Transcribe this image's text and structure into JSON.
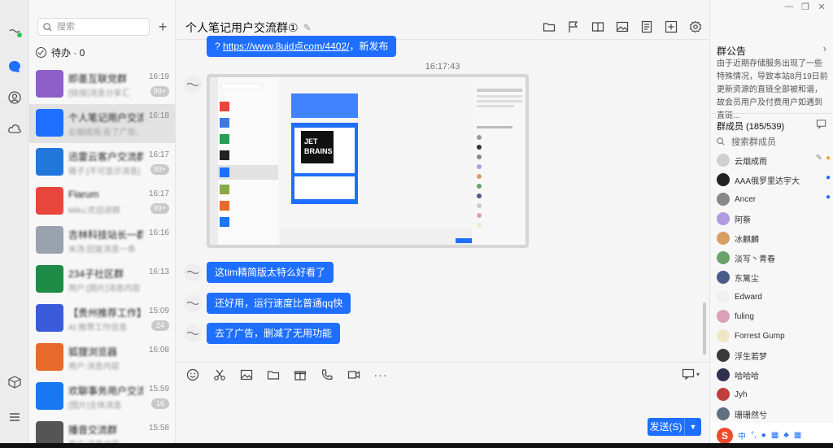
{
  "search": {
    "placeholder": "搜索"
  },
  "todo": {
    "label": "待办 · 0"
  },
  "conversations": [
    {
      "name": "即墨互联党群",
      "preview": "[链接]消息分享汇",
      "time": "16:19",
      "badge": "99+",
      "color": "#8f5fc9"
    },
    {
      "name": "个人笔记用户交流群",
      "preview": "云烟成雨:去了广告、删除",
      "time": "16:18",
      "badge": "",
      "color": "#1e6fff"
    },
    {
      "name": "迅雷云客户交流群",
      "preview": "猪子:[不可显示消息]",
      "time": "16:17",
      "badge": "99+",
      "color": "#2277dd"
    },
    {
      "name": "Flarum",
      "preview": "Miku:欢迎进群",
      "time": "16:17",
      "badge": "99+",
      "color": "#e8453c"
    },
    {
      "name": "吉林科技站长一群",
      "preview": "米汤:回复消息一条",
      "time": "16:16",
      "badge": "",
      "color": "#9aa3ad"
    },
    {
      "name": "234子社区群",
      "preview": "用户:[图片]消息内容",
      "time": "16:13",
      "badge": "",
      "color": "#1e8c46"
    },
    {
      "name": "【贵州推荐工作】",
      "preview": "AI:推荐工作信息",
      "time": "15:09",
      "badge": "24",
      "color": "#3a5bd9"
    },
    {
      "name": "狐狸浏览器",
      "preview": "用户:消息内容",
      "time": "16:08",
      "badge": "",
      "color": "#e86a2a"
    },
    {
      "name": "欢聊事务用户交流群",
      "preview": "[图片]全体消息",
      "time": "15:59",
      "badge": "16",
      "color": "#1877f2"
    },
    {
      "name": "播音交流群",
      "preview": "用户:消息内容",
      "time": "15:58",
      "badge": "",
      "color": "#555555"
    }
  ],
  "chat": {
    "title": "个人笔记用户交流群",
    "title_count": "①",
    "first_message": {
      "prefix": "? ",
      "link": "https://www.8uid点com/4402/",
      "suffix": "，新发布"
    },
    "timestamp": "16:17:43",
    "messages": [
      "这tim精简版太特么好看了",
      "还好用，运行速度比普通qq快",
      "去了广告，删减了无用功能"
    ],
    "send_label": "发送(S)"
  },
  "announcement": {
    "title": "群公告",
    "body": "由于近期存储服务出现了一些特殊情况，导致本站8月19日前更新资源的直链全部被和谐，故会员用户及付费用户如遇到直链..."
  },
  "members": {
    "title": "群成员 (185/539)",
    "search_placeholder": "搜索群成员",
    "list": [
      {
        "name": "云烟成雨",
        "color": "#cfcfcf",
        "edit": true,
        "admin": "owner"
      },
      {
        "name": "AAA俄罗里达宇大",
        "color": "#222222",
        "edit": false,
        "admin": "admin"
      },
      {
        "name": "Ancer",
        "color": "#888888",
        "edit": false,
        "admin": "admin"
      },
      {
        "name": "阿蔡",
        "color": "#b19be0",
        "edit": false,
        "admin": ""
      },
      {
        "name": "冰麒麟",
        "color": "#d6a060",
        "edit": false,
        "admin": ""
      },
      {
        "name": "淡写丶青春",
        "color": "#6aa36a",
        "edit": false,
        "admin": ""
      },
      {
        "name": "东篱尘",
        "color": "#4a5a8a",
        "edit": false,
        "admin": ""
      },
      {
        "name": "Edward",
        "color": "#f0f0f0",
        "edit": false,
        "admin": ""
      },
      {
        "name": "fuling",
        "color": "#d9a0b8",
        "edit": false,
        "admin": ""
      },
      {
        "name": "Forrest Gump",
        "color": "#f2e6c9",
        "edit": false,
        "admin": ""
      },
      {
        "name": "浮生若梦",
        "color": "#3a3a3a",
        "edit": false,
        "admin": ""
      },
      {
        "name": "哈哈哈",
        "color": "#303050",
        "edit": false,
        "admin": ""
      },
      {
        "name": "Jyh",
        "color": "#c04040",
        "edit": false,
        "admin": ""
      },
      {
        "name": "珊珊然兮",
        "color": "#607080",
        "edit": false,
        "admin": ""
      }
    ]
  },
  "tray": {
    "ime": "中",
    "punct": "°,"
  },
  "icons": {
    "rail": [
      "avatar-dot-icon",
      "chat-bubble-icon",
      "contacts-icon",
      "cloud-icon",
      "cube-icon",
      "menu-icon"
    ],
    "top": [
      "folder-icon",
      "flag-icon",
      "book-icon",
      "image-icon",
      "doc-icon",
      "add-box-icon",
      "settings-icon"
    ],
    "compose": [
      "emoji-icon",
      "scissors-icon",
      "image-icon",
      "folder-icon",
      "gift-icon",
      "phone-icon",
      "video-icon",
      "more-icon"
    ]
  },
  "accent": "#1e6fff"
}
